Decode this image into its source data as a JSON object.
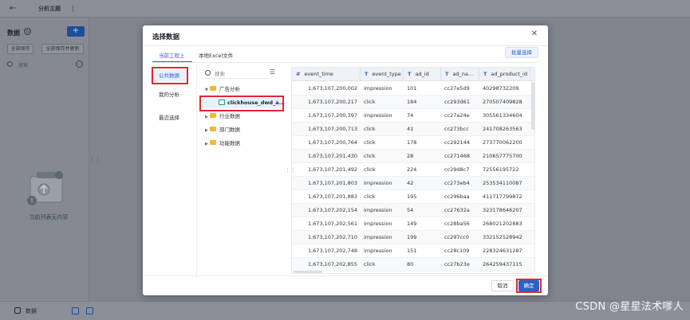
{
  "app": {
    "topic_title": "分析主题",
    "left_panel": {
      "title": "数据",
      "add_label": "+",
      "save_all": "全部保存",
      "save_all_update": "全部保存并更新",
      "search_placeholder": "搜索",
      "empty_text": "当前列表无内容"
    },
    "bottom": {
      "data_tab": "数据"
    }
  },
  "modal": {
    "title": "选择数据",
    "tabs": [
      {
        "label": "当前工程上",
        "active": true
      },
      {
        "label": "本地Excel文件",
        "active": false
      }
    ],
    "batch_select": "批量选择",
    "sidebar": [
      {
        "label": "公共数据",
        "active": true
      },
      {
        "label": "我的分析",
        "active": false
      },
      {
        "label": "最近选择",
        "active": false
      }
    ],
    "tree": {
      "search_placeholder": "搜索",
      "nodes": [
        {
          "label": "广告分析",
          "type": "folder",
          "expanded": true
        },
        {
          "label": "clickhouse_dwd_a...",
          "type": "table",
          "selected": true
        },
        {
          "label": "行业数据",
          "type": "folder"
        },
        {
          "label": "部门数据",
          "type": "folder"
        },
        {
          "label": "功能数据",
          "type": "folder"
        }
      ]
    },
    "grid": {
      "columns": [
        {
          "label": "event_time",
          "type_icon": "#"
        },
        {
          "label": "event_type",
          "type_icon": "T"
        },
        {
          "label": "ad_id",
          "type_icon": "T"
        },
        {
          "label": "ad_na...",
          "type_icon": "T"
        },
        {
          "label": "ad_product_id",
          "type_icon": "T"
        }
      ],
      "rows": [
        [
          "1,673,107,200,002",
          "impression",
          "101",
          "cc27e5d9",
          "40298732209"
        ],
        [
          "1,673,107,200,217",
          "click",
          "184",
          "cc293d61",
          "270507409828"
        ],
        [
          "1,673,107,200,397",
          "impression",
          "74",
          "cc27a24e",
          "305561334604"
        ],
        [
          "1,673,107,200,713",
          "click",
          "41",
          "cc273bcc",
          "241708263563"
        ],
        [
          "1,673,107,200,764",
          "click",
          "178",
          "cc292144",
          "273770062200"
        ],
        [
          "1,673,107,201,430",
          "click",
          "28",
          "cc271468",
          "210657775700"
        ],
        [
          "1,673,107,201,492",
          "click",
          "224",
          "cc29d8c7",
          "72556195722"
        ],
        [
          "1,673,107,201,803",
          "impression",
          "42",
          "cc273eb4",
          "253534110087"
        ],
        [
          "1,673,107,201,883",
          "click",
          "195",
          "cc296baa",
          "411717799872"
        ],
        [
          "1,673,107,202,154",
          "impression",
          "54",
          "cc27632a",
          "323178646207"
        ],
        [
          "1,673,107,202,561",
          "impression",
          "149",
          "cc28ba56",
          "268021202883"
        ],
        [
          "1,673,107,202,710",
          "impression",
          "199",
          "cc297cc0",
          "332152528942"
        ],
        [
          "1,673,107,202,748",
          "impression",
          "151",
          "cc28c109",
          "228324631287"
        ],
        [
          "1,673,107,202,855",
          "click",
          "80",
          "cc27b23e",
          "264259437115"
        ]
      ]
    },
    "cancel": "取消",
    "confirm": "确定"
  },
  "watermark": "CSDN @星星法术嗲人",
  "colors": {
    "accent": "#2b62c6",
    "highlight_box": "#e0282e",
    "folder": "#f3b63a"
  }
}
